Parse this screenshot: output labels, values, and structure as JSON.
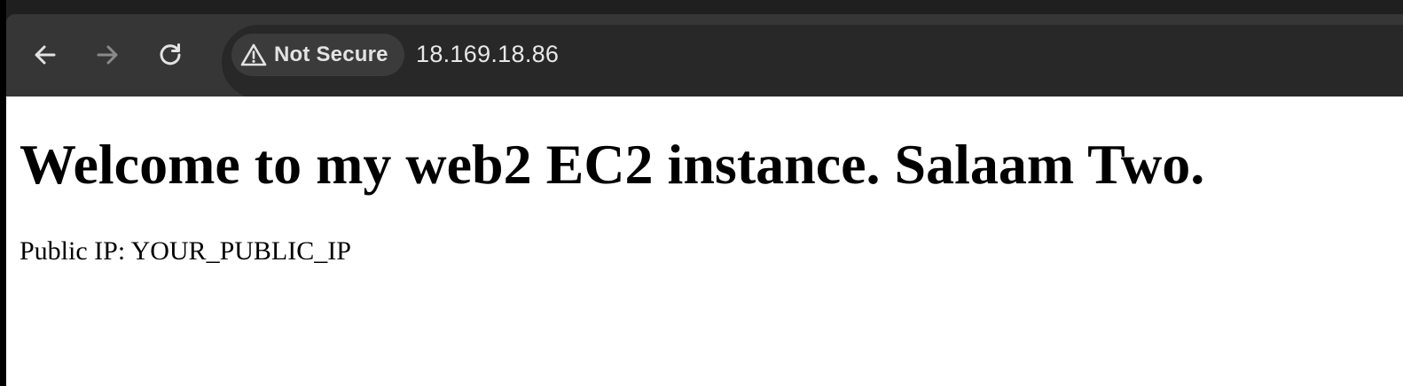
{
  "browser": {
    "toolbar": {
      "back_icon": "arrow-left-icon",
      "forward_icon": "arrow-right-icon",
      "reload_icon": "reload-icon"
    },
    "omnibox": {
      "security_label": "Not Secure",
      "security_icon": "warning-triangle-icon",
      "url": "18.169.18.86"
    },
    "colors": {
      "toolbar_bg": "#363636",
      "omnibox_bg": "#282828",
      "chip_bg": "#3b3b3b",
      "disabled_icon": "#8a8a8a",
      "enabled_icon": "#e3e3e3"
    }
  },
  "page": {
    "heading": "Welcome to my web2 EC2 instance. Salaam Two.",
    "paragraph": "Public IP: YOUR_PUBLIC_IP"
  }
}
